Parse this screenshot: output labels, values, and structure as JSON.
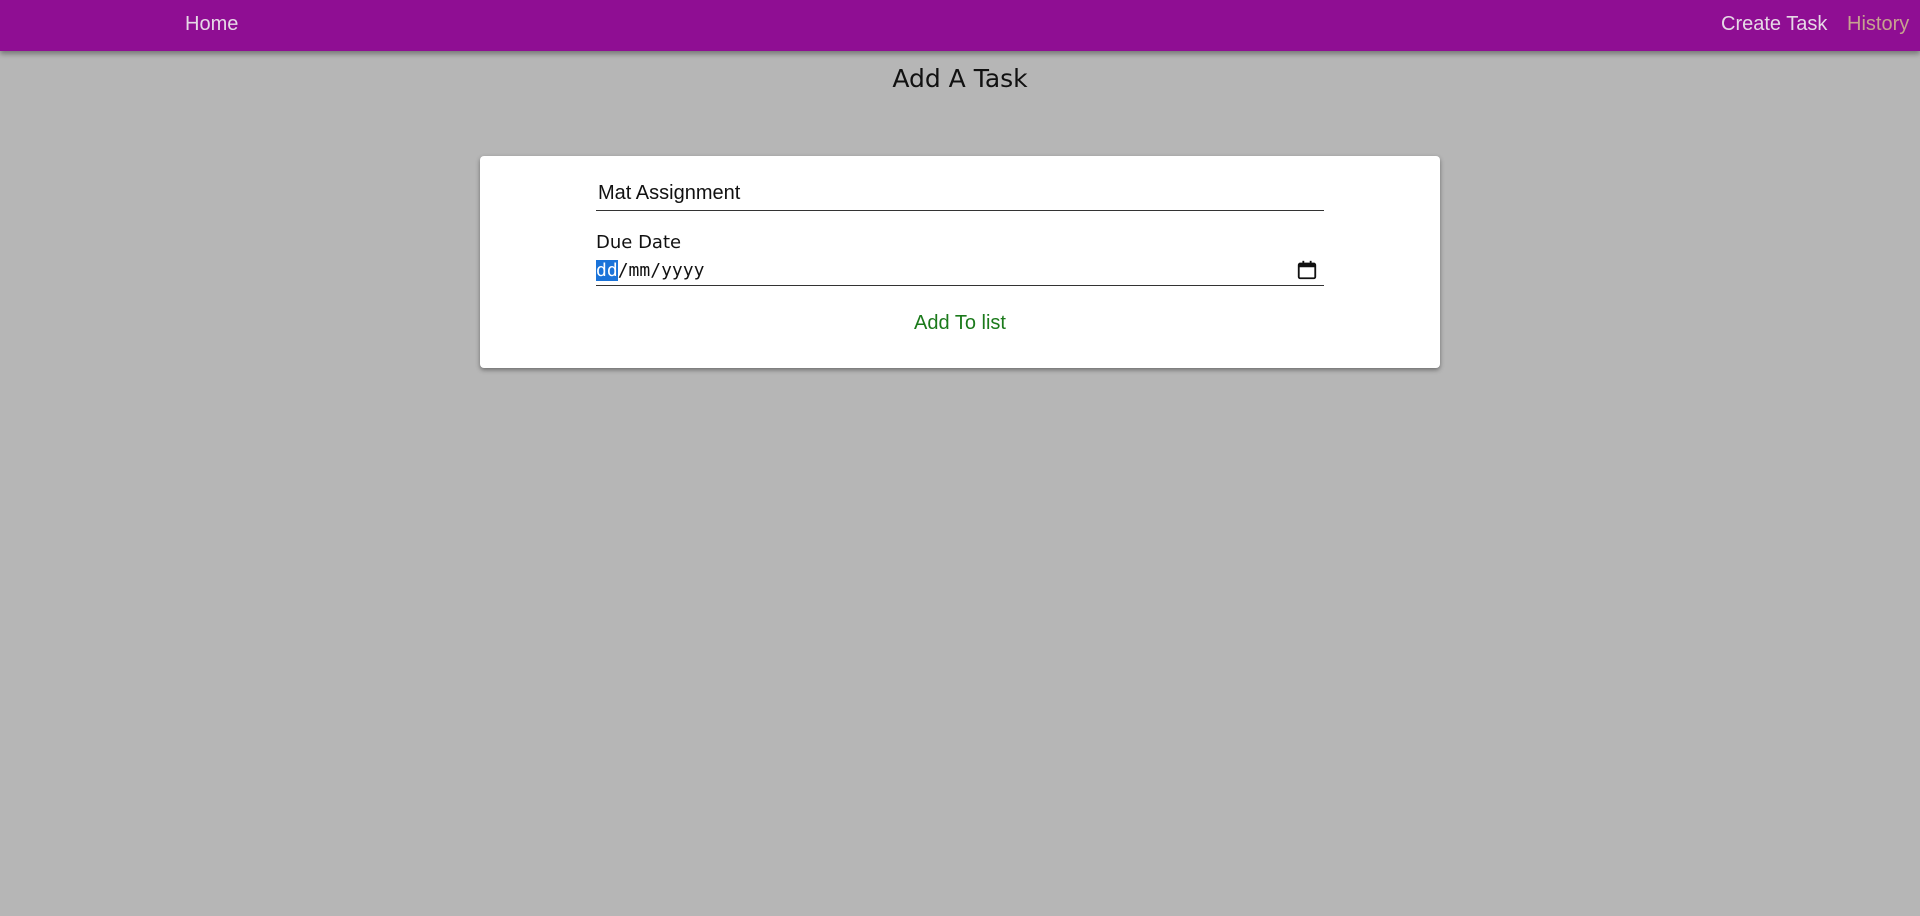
{
  "nav": {
    "home": "Home",
    "create_task": "Create Task",
    "history": "History"
  },
  "page": {
    "title": "Add A Task"
  },
  "form": {
    "task_value": "Mat Assignment",
    "due_label": "Due Date",
    "date_day": "dd",
    "date_sep1": "/",
    "date_month": "mm",
    "date_sep2": "/",
    "date_year": "yyyy",
    "submit_label": "Add To list"
  },
  "colors": {
    "navbar": "#8f0e93",
    "background": "#b6b6b6",
    "submit_text": "#1b7a1b",
    "selection": "#1a73d9"
  },
  "icons": {
    "date_picker": "calendar-icon"
  }
}
